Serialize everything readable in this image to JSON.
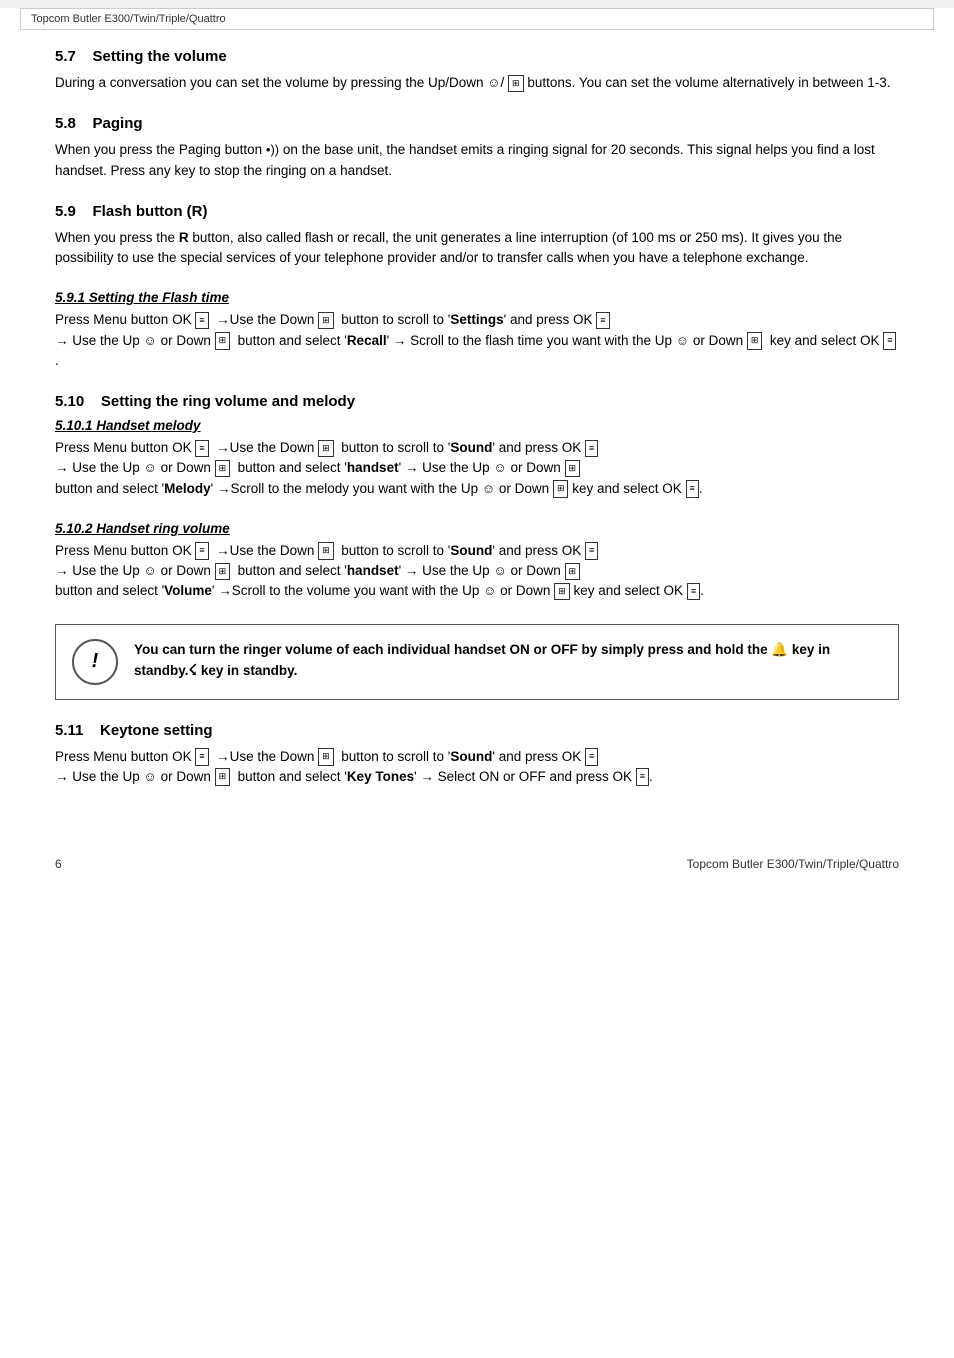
{
  "header": {
    "text": "Topcom Butler E300/Twin/Triple/Quattro"
  },
  "footer": {
    "page_number": "6",
    "model": "Topcom Butler E300/Twin/Triple/Quattro"
  },
  "sections": [
    {
      "id": "5.7",
      "title": "5.7    Setting the volume",
      "body": "During a conversation you can set the volume by pressing the Up/Down ☎/ 🔊 buttons. You can set the volume alternatively in between 1-3."
    },
    {
      "id": "5.8",
      "title": "5.8    Paging",
      "body": "When you press the Paging button •)) on the base unit, the handset emits a ringing signal for 20 seconds. This signal helps you find a lost handset. Press any key to stop the ringing on a handset."
    },
    {
      "id": "5.9",
      "title": "5.9    Flash button (R)",
      "body": "When you press the R button, also called flash or recall, the unit generates a line interruption (of 100 ms or 250 ms). It gives you the possibility to use the special services of your telephone provider and/or to transfer calls when you have a telephone exchange."
    },
    {
      "id": "5.9.1",
      "title": "5.9.1 Setting the Flash time",
      "type": "subsection",
      "body": "Press Menu button OK ☰ →Use the Down 🔊 button to scroll to 'Settings' and press OK ☰ → Use the Up ☎ or Down 🔊 button and select 'Recall' → Scroll to the flash time you want with the Up ☎ or Down 🔊 key and select OK ☰."
    },
    {
      "id": "5.10",
      "title": "5.10    Setting the ring volume and melody"
    },
    {
      "id": "5.10.1",
      "title": "5.10.1 Handset melody",
      "type": "subsection",
      "body": "Press Menu button OK ☰ →Use the Down 🔊 button to scroll to 'Sound' and press OK ☰ → Use the Up ☎ or Down 🔊 button and select 'handset' → Use the Up ☎ or Down 🔊 button and select 'Melody' →Scroll to the melody you want with the Up ☎ or Down 🔊 key and select OK ☰."
    },
    {
      "id": "5.10.2",
      "title": "5.10.2 Handset ring volume",
      "type": "subsection",
      "body": "Press Menu button OK ☰ →Use the Down 🔊 button to scroll to 'Sound' and press OK ☰ → Use the Up ☎ or Down 🔊 button and select 'handset' → Use the Up ☎ or Down 🔊 button and select 'Volume' →Scroll to the volume you want with the Up ☎ or Down 🔊 key and select OK ☰."
    },
    {
      "id": "5.11",
      "title": "5.11    Keytone setting",
      "body": "Press Menu button OK ☰ →Use the Down 🔊 button to scroll to 'Sound' and press OK ☰ → Use the Up ☎ or Down 🔊 button and select 'Key Tones' → Select ON or OFF and press OK ☰."
    }
  ],
  "note_box": {
    "text": "You can turn the ringer volume of each individual handset ON or OFF by simply press and hold the 🔔 key in standby."
  },
  "icons": {
    "ok_icon": "OK",
    "nav_icon": "⊟",
    "person_icon": "☎",
    "menu_lines": "☰",
    "arrow_right": "→",
    "mute_bell": "🔕"
  }
}
